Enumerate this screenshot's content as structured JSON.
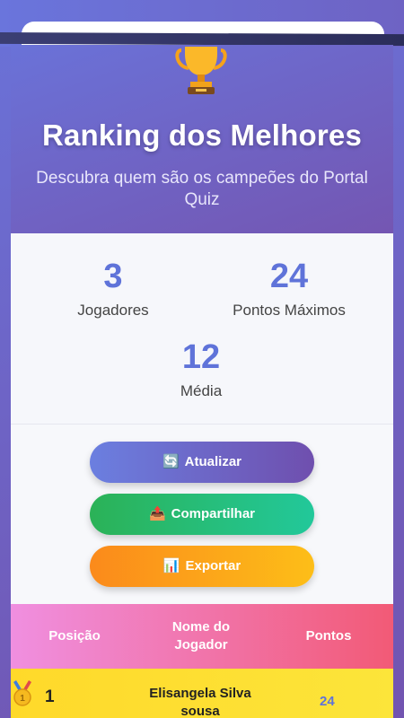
{
  "header": {
    "title": "Ranking dos Melhores",
    "subtitle": "Descubra quem são os campeões do Portal Quiz",
    "icon": "trophy-icon"
  },
  "stats": [
    {
      "value": "3",
      "label": "Jogadores"
    },
    {
      "value": "24",
      "label": "Pontos Máximos"
    },
    {
      "value": "12",
      "label": "Média"
    }
  ],
  "actions": [
    {
      "icon": "🔄",
      "label": "Atualizar"
    },
    {
      "icon": "📤",
      "label": "Compartilhar"
    },
    {
      "icon": "📊",
      "label": "Exportar"
    }
  ],
  "table": {
    "columns": [
      "Posição",
      "Nome do Jogador",
      "Pontos"
    ],
    "rows": [
      {
        "medal": "gold-medal-icon",
        "position": "1",
        "name": "Elisangela Silva sousa",
        "points": "24"
      }
    ]
  },
  "colors": {
    "accent": "#5f73d9",
    "gold": "#ffd92a",
    "success": "#2bb257",
    "warning": "#fb8a1b"
  }
}
